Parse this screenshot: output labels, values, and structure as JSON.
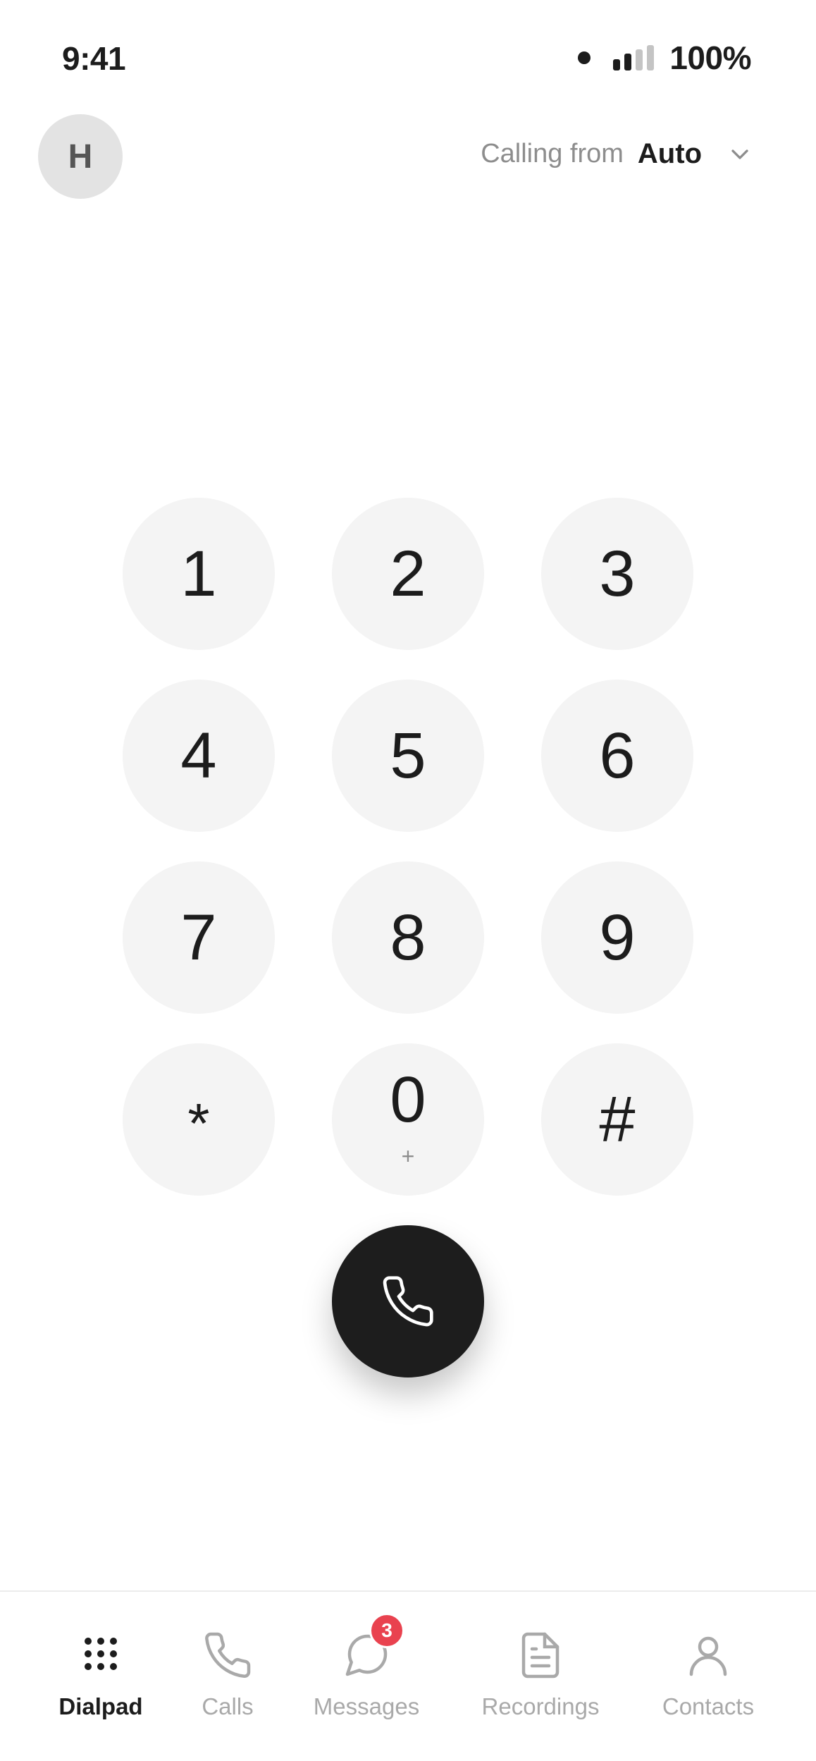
{
  "status_bar": {
    "time": "9:41",
    "battery": "100%",
    "signal_bars_filled": 2,
    "signal_bars_total": 4
  },
  "header": {
    "avatar_initial": "H",
    "calling_from_label": "Calling from",
    "calling_from_value": "Auto"
  },
  "keypad": {
    "keys": [
      {
        "digit": "1",
        "sub": ""
      },
      {
        "digit": "2",
        "sub": ""
      },
      {
        "digit": "3",
        "sub": ""
      },
      {
        "digit": "4",
        "sub": ""
      },
      {
        "digit": "5",
        "sub": ""
      },
      {
        "digit": "6",
        "sub": ""
      },
      {
        "digit": "7",
        "sub": ""
      },
      {
        "digit": "8",
        "sub": ""
      },
      {
        "digit": "9",
        "sub": ""
      },
      {
        "digit": "*",
        "sub": ""
      },
      {
        "digit": "0",
        "sub": "+"
      },
      {
        "digit": "#",
        "sub": ""
      }
    ],
    "call_icon": "phone-icon"
  },
  "nav": {
    "items": [
      {
        "label": "Dialpad",
        "icon": "dialpad-icon",
        "active": true
      },
      {
        "label": "Calls",
        "icon": "phone-icon",
        "active": false
      },
      {
        "label": "Messages",
        "icon": "message-icon",
        "active": false,
        "badge": "3"
      },
      {
        "label": "Recordings",
        "icon": "document-icon",
        "active": false
      },
      {
        "label": "Contacts",
        "icon": "person-icon",
        "active": false
      }
    ]
  },
  "colors": {
    "key_background": "#f4f4f4",
    "call_button": "#1d1d1d",
    "badge": "#e9424f",
    "active_nav": "#1c1c1c",
    "inactive_nav": "#a9a9a9"
  }
}
